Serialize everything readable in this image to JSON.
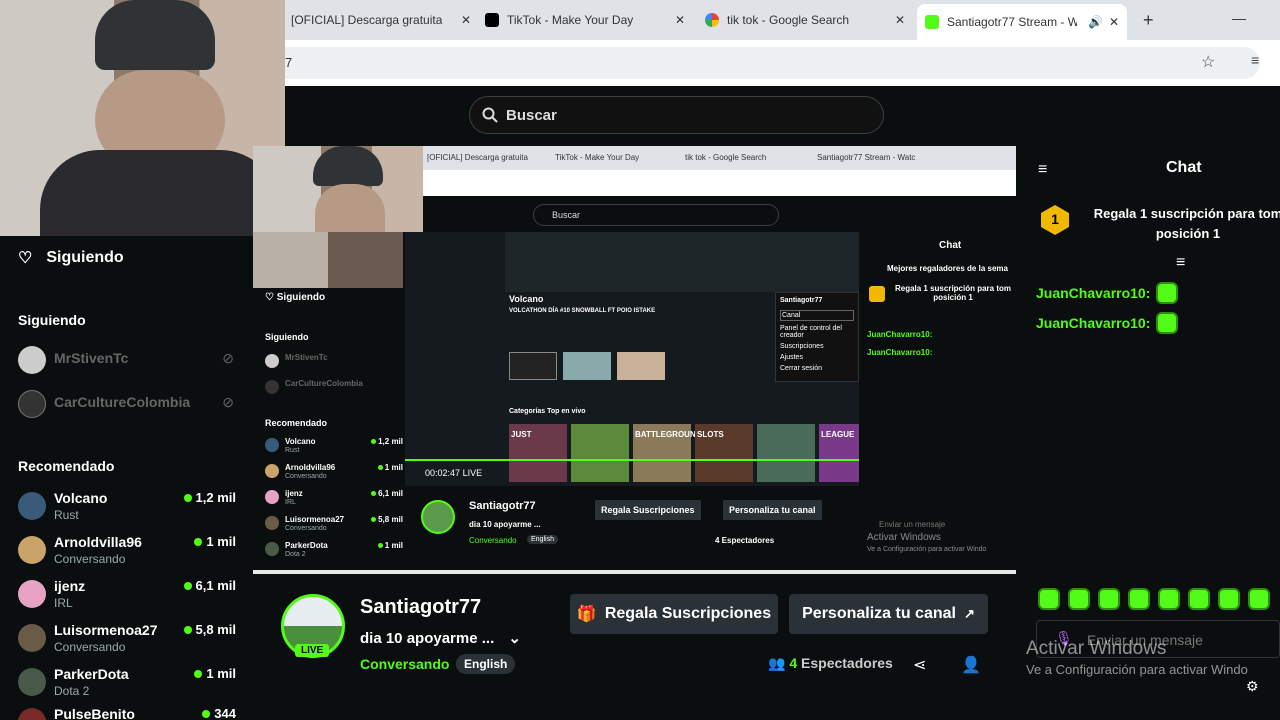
{
  "browser": {
    "tabs": [
      {
        "label": "[OFICIAL] Descarga gratuita",
        "active": false
      },
      {
        "label": "TikTok - Make Your Day",
        "active": false
      },
      {
        "label": "tik tok - Google Search",
        "active": false
      },
      {
        "label": "Santiagotr77 Stream - W",
        "active": true
      }
    ],
    "address": "7"
  },
  "header": {
    "search_placeholder": "Buscar"
  },
  "sidebar": {
    "title": "Siguiendo",
    "following_label": "Siguiendo",
    "following": [
      {
        "name": "MrStivenTc"
      },
      {
        "name": "CarCultureColombia"
      }
    ],
    "recommended_label": "Recomendado",
    "recommended": [
      {
        "name": "Volcano",
        "category": "Rust",
        "viewers": "1,2 mil"
      },
      {
        "name": "Arnoldvilla96",
        "category": "Conversando",
        "viewers": "1 mil"
      },
      {
        "name": "ijenz",
        "category": "IRL",
        "viewers": "6,1 mil"
      },
      {
        "name": "Luisormenoa27",
        "category": "Conversando",
        "viewers": "5,8 mil"
      },
      {
        "name": "ParkerDota",
        "category": "Dota 2",
        "viewers": "1 mil"
      },
      {
        "name": "PulseBenito",
        "category": "",
        "viewers": "344"
      }
    ]
  },
  "nested": {
    "tabs": [
      "[OFICIAL] Descarga gratuita",
      "TikTok - Make Your Day",
      "tik tok - Google Search",
      "Santiagotr77 Stream - Watc"
    ],
    "search": "Buscar",
    "sidebar_title": "Siguiendo",
    "following_label": "Siguiendo",
    "following": [
      "MrStivenTc",
      "CarCultureColombia"
    ],
    "recommended_label": "Recomendado",
    "recommended": [
      {
        "name": "Volcano",
        "category": "Rust",
        "viewers": "1,2 mil"
      },
      {
        "name": "Arnoldvilla96",
        "category": "Conversando",
        "viewers": "1 mil"
      },
      {
        "name": "ijenz",
        "category": "IRL",
        "viewers": "6,1 mil"
      },
      {
        "name": "Luisormenoa27",
        "category": "Conversando",
        "viewers": "5,8 mil"
      },
      {
        "name": "ParkerDota",
        "category": "Dota 2",
        "viewers": "1 mil"
      }
    ],
    "video_header": "Volcano",
    "video_subtitle": "VOLCATHON DÍA #10 SNOWBALL FT POIO ISTAKE",
    "time": "00:02:47",
    "live_label": "LIVE",
    "categories_label": "Categorías Top en vivo",
    "categories": [
      "JUST",
      "",
      "BATTLEGROUNDS",
      "SLOTS",
      "",
      "LEAGUE"
    ],
    "menu": [
      "Santiagotr77",
      "Canal",
      "Panel de control del creador",
      "Suscripciones",
      "Ajustes",
      "Cerrar sesión"
    ],
    "chat_title": "Chat",
    "chat_top": "Mejores regaladores de la sema",
    "chat_gift": "Regala 1 suscripción para tom posición 1",
    "chat_msgs": [
      "JuanChavarro10:",
      "JuanChavarro10:"
    ],
    "stream_name": "Santiagotr77",
    "stream_title": "dia  10 apoyarme ...",
    "stream_cat": "Conversando",
    "stream_lang": "English",
    "gift_btn": "Regala Suscripciones",
    "custom_btn": "Personaliza tu canal",
    "viewers": "4 Espectadores",
    "chat_input": "Enviar un mensaje",
    "watermark1": "Activar Windows",
    "watermark2": "Ve a Configuración para activar Windo"
  },
  "stream": {
    "name": "Santiagotr77",
    "live": "LIVE",
    "title": "dia  10 apoyarme ...",
    "category": "Conversando",
    "language": "English",
    "gift_button": "Regala Suscripciones",
    "customize_button": "Personaliza tu canal",
    "viewers_count": "4",
    "viewers_label": "Espectadores"
  },
  "chat": {
    "title": "Chat",
    "gift_rank": "1",
    "gift_text": "Regala 1 suscripción para tom posición 1",
    "messages": [
      {
        "user": "JuanChavarro10:"
      },
      {
        "user": "JuanChavarro10:"
      }
    ],
    "input_placeholder": "Enviar un mensaje"
  },
  "watermark": {
    "line1": "Activar Windows",
    "line2": "Ve a Configuración para activar Windo"
  }
}
